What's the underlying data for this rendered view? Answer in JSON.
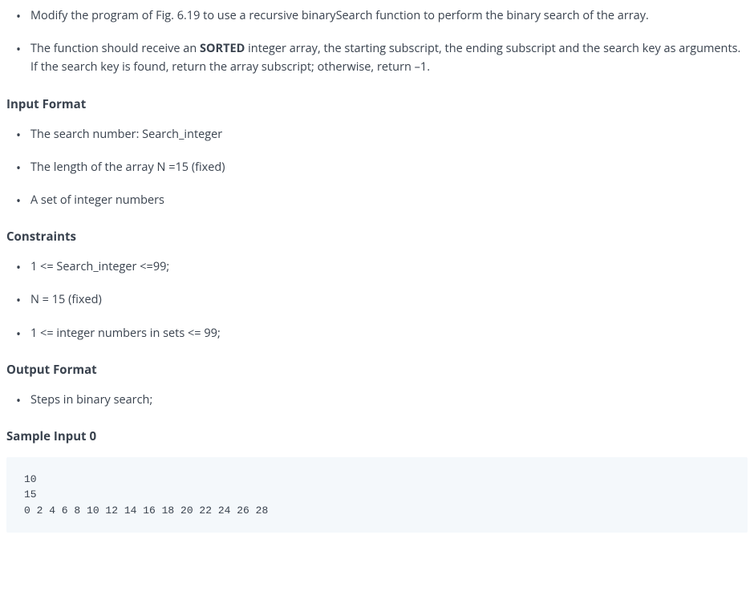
{
  "description": {
    "items": [
      {
        "text_before": "Modify the program of Fig. 6.19 to use a recursive binarySearch function to perform the binary search of the array."
      },
      {
        "text_before": "The function should receive an ",
        "bold": "SORTED",
        "text_after": " integer array, the starting subscript, the ending subscript and the search key as arguments. If the search key is found, return the array subscript; otherwise, return –1."
      }
    ]
  },
  "sections": {
    "input_format": {
      "title": "Input Format",
      "items": [
        "The search number: Search_integer",
        "The length of the array N =15 (fixed)",
        "A set of integer numbers"
      ]
    },
    "constraints": {
      "title": "Constraints",
      "items": [
        "1 <= Search_integer <=99;",
        "N = 15 (fixed)",
        "1 <= integer numbers in sets <= 99;"
      ]
    },
    "output_format": {
      "title": "Output Format",
      "items": [
        "Steps in binary search;"
      ]
    },
    "sample_input_0": {
      "title": "Sample Input 0",
      "code": "10\n15\n0 2 4 6 8 10 12 14 16 18 20 22 24 26 28"
    }
  }
}
